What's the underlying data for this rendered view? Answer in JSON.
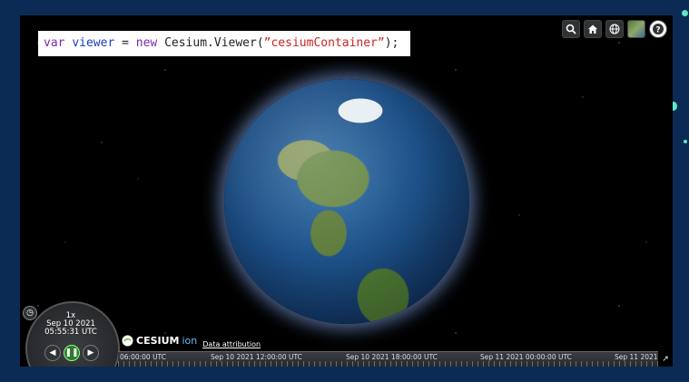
{
  "code": {
    "kw1": "var",
    "sp1": " ",
    "varname": "viewer",
    "op": " = ",
    "kw2": "new",
    "cls": " Cesium.Viewer(",
    "str": "”cesiumContainer”",
    "end": ");"
  },
  "toolbar": {
    "search_icon": "search-icon",
    "home_icon": "home-icon",
    "globe_icon": "globe-icon",
    "map_icon": "base-layer-picker",
    "help_icon": "help-icon"
  },
  "animation": {
    "speed": "1x",
    "date": "Sep 10 2021",
    "time": "05:55:31 UTC"
  },
  "credits": {
    "logo_cesium": "CESIUM",
    "logo_ion": "ion",
    "attribution": "Data attribution"
  },
  "timeline": {
    "labels": [
      "06:00:00 UTC",
      "Sep 10 2021 12:00:00 UTC",
      "Sep 10 2021 18:00:00 UTC",
      "Sep 11 2021 00:00:00 UTC",
      "Sep 11 2021"
    ]
  }
}
